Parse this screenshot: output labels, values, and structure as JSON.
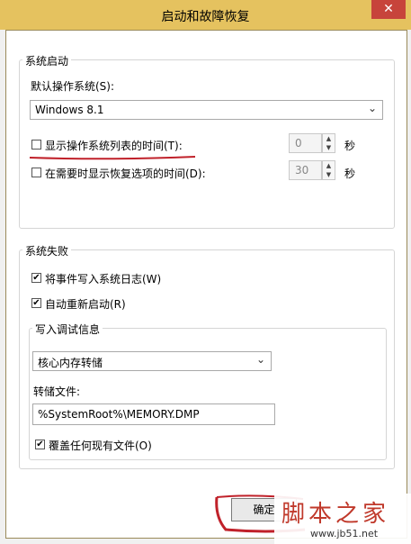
{
  "window": {
    "title": "启动和故障恢复",
    "close_glyph": "✕"
  },
  "startup": {
    "group_label": "系统启动",
    "default_os_label": "默认操作系统(S):",
    "default_os_value": "Windows 8.1",
    "show_os_list_label": "显示操作系统列表的时间(T):",
    "show_os_list_checked": false,
    "show_os_list_seconds": "0",
    "show_recovery_label": "在需要时显示恢复选项的时间(D):",
    "show_recovery_checked": false,
    "show_recovery_seconds": "30",
    "seconds_unit": "秒"
  },
  "failure": {
    "group_label": "系统失败",
    "write_event_label": "将事件写入系统日志(W)",
    "write_event_checked": true,
    "auto_restart_label": "自动重新启动(R)",
    "auto_restart_checked": true,
    "debug_group_label": "写入调试信息",
    "debug_type_value": "核心内存转储",
    "dump_file_label": "转储文件:",
    "dump_file_value": "%SystemRoot%\\MEMORY.DMP",
    "overwrite_label": "覆盖任何现有文件(O)",
    "overwrite_checked": true
  },
  "buttons": {
    "ok_label": "确定"
  },
  "watermark": {
    "title": "脚本之家",
    "url": "www.jb51.net"
  },
  "colors": {
    "titlebar": "#e5c25f",
    "close": "#c7443b",
    "annotation": "#c0212a"
  },
  "icons": {
    "check": "✔",
    "spin_up": "▲",
    "spin_down": "▼",
    "dropdown": "⌄"
  }
}
